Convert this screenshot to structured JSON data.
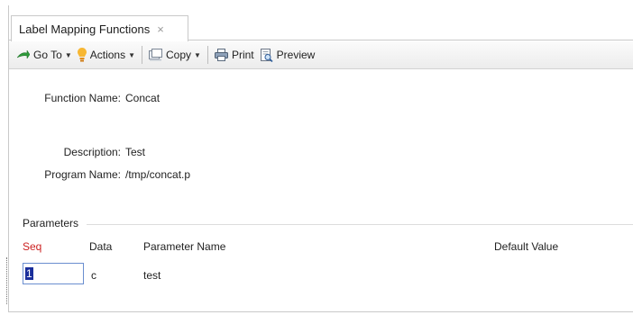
{
  "tab": {
    "title": "Label Mapping Functions",
    "close_glyph": "×"
  },
  "toolbar": {
    "goto_label": "Go To",
    "actions_label": "Actions",
    "copy_label": "Copy",
    "print_label": "Print",
    "preview_label": "Preview"
  },
  "form": {
    "function_name_label": "Function Name:",
    "function_name_value": "Concat",
    "description_label": "Description:",
    "description_value": "Test",
    "program_name_label": "Program Name:",
    "program_name_value": "/tmp/concat.p"
  },
  "parameters": {
    "section_title": "Parameters",
    "columns": [
      "Seq",
      "Data",
      "Parameter Name",
      "Default Value"
    ],
    "rows": [
      {
        "seq": "1",
        "data": "c",
        "parameter_name": "test",
        "default_value": ""
      }
    ]
  },
  "colors": {
    "seq_header": "#cc2222",
    "selection": "#1a2e9b",
    "input_border": "#6a8ed0"
  }
}
